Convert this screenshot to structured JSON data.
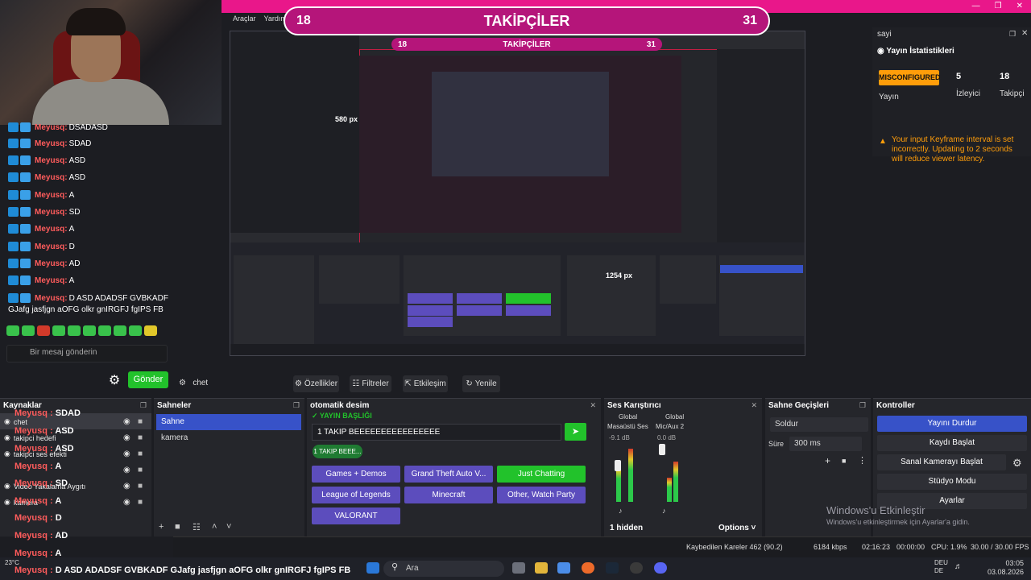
{
  "menu": [
    "Araçlar",
    "Yardım"
  ],
  "banner": {
    "left": "18",
    "label": "TAKİPÇİLER",
    "right": "31"
  },
  "chat": {
    "messages": [
      {
        "user": "Meyusq:",
        "text": "DSADASD"
      },
      {
        "user": "Meyusq:",
        "text": "SDAD"
      },
      {
        "user": "Meyusq:",
        "text": "ASD"
      },
      {
        "user": "Meyusq:",
        "text": "ASD"
      },
      {
        "user": "Meyusq:",
        "text": "A"
      },
      {
        "user": "Meyusq:",
        "text": "SD"
      },
      {
        "user": "Meyusq:",
        "text": "A"
      },
      {
        "user": "Meyusq:",
        "text": "D"
      },
      {
        "user": "Meyusq:",
        "text": "AD"
      },
      {
        "user": "Meyusq:",
        "text": "A"
      },
      {
        "user": "Meyusq:",
        "text": "D ASD ADADSF GVBKADF"
      }
    ],
    "last_line": "GJafg jasfjgn aOFG olkr gnIRGFJ fgIPS FB",
    "input_placeholder": "Bir mesaj gönderin",
    "send": "Gönder"
  },
  "preview": {
    "measure_a": "580 px",
    "measure_b": "1254 px"
  },
  "stats": {
    "dock_title": "sayi",
    "heading": "Yayın İstatistikleri",
    "status": "MISCONFIGURED",
    "status_label": "Yayın",
    "viewers_value": "5",
    "viewers_label": "İzleyici",
    "followers_value": "18",
    "followers_label": "Takipçi",
    "warning": "Your input Keyframe interval is set incorrectly. Updating to 2 seconds will reduce viewer latency."
  },
  "toolbar": {
    "source": "chet",
    "properties": "Özellikler",
    "filters": "Filtreler",
    "interact": "Etkileşim",
    "refresh": "Yenile"
  },
  "docks": {
    "sources": {
      "title": "Kaynaklar",
      "items": [
        "chet",
        "takipci hedefi",
        "takipci ses efekti",
        "Video Yakalama Aygıtı",
        "kamera"
      ]
    },
    "scenes": {
      "title": "Sahneler",
      "items": [
        "Sahne",
        "kamera"
      ]
    },
    "otomatik": {
      "title": "otomatik desim",
      "section": "YAYIN BAŞLIĞI",
      "title_value": "1 TAKIP BEEEEEEEEEEEEEEEE",
      "chip": "1 TAKIP BEEE...",
      "games": [
        "Games + Demos",
        "Grand Theft Auto V...",
        "Just Chatting",
        "League of Legends",
        "Minecraft",
        "Other, Watch Party",
        "VALORANT"
      ]
    },
    "mixer": {
      "title": "Ses Karıştırıcı",
      "tab_a": "Global",
      "tab_b": "Global",
      "ch_a": "Masaüstü Ses",
      "ch_b": "Mic/Aux 2",
      "db_a": "-9.1 dB",
      "db_b": "0.0 dB",
      "hidden": "1 hidden",
      "options": "Options"
    },
    "transitions": {
      "title": "Sahne Geçişleri",
      "type": "Soldur",
      "duration_label": "Süre",
      "duration": "300 ms"
    },
    "controls": {
      "title": "Kontroller",
      "buttons": [
        "Yayını Durdur",
        "Kaydı Başlat",
        "Sanal Kamerayı Başlat",
        "Stüdyo Modu",
        "Ayarlar"
      ]
    }
  },
  "overlay_msgs": [
    {
      "user": "Meyusq :",
      "text": "SDAD"
    },
    {
      "user": "Meyusq :",
      "text": "ASD"
    },
    {
      "user": "Meyusq :",
      "text": "ASD"
    },
    {
      "user": "Meyusq :",
      "text": "A"
    },
    {
      "user": "Meyusq :",
      "text": "SD"
    },
    {
      "user": "Meyusq :",
      "text": "A"
    },
    {
      "user": "Meyusq :",
      "text": "D"
    },
    {
      "user": "Meyusq :",
      "text": "AD"
    },
    {
      "user": "Meyusq :",
      "text": "A"
    },
    {
      "user": "Meyusq :",
      "text": "D ASD ADADSF GVBKADF GJafg jasfjgn aOFG olkr gnIRGFJ fgIPS FB"
    }
  ],
  "status": {
    "dropped": "Kaybedilen Kareler 462 (90.2)",
    "kbps": "6184 kbps",
    "live": "02:16:23",
    "rec": "00:00:00",
    "cpu": "CPU: 1.9%",
    "fps": "30.00 / 30.00 FPS"
  },
  "windows_watermark": {
    "line1": "Windows'u Etkinleştir",
    "line2": "Windows'u etkinleştirmek için Ayarlar'a gidin."
  },
  "taskbar": {
    "search": "Ara",
    "weather": "23°C",
    "lang1": "DEU",
    "lang2": "DE",
    "time": "03:05",
    "date": "03.08.2026"
  },
  "colors": {
    "accent": "#e9178a",
    "obs_blue": "#3752c8",
    "green": "#22c22b",
    "chat_user": "#ff5c5c"
  }
}
